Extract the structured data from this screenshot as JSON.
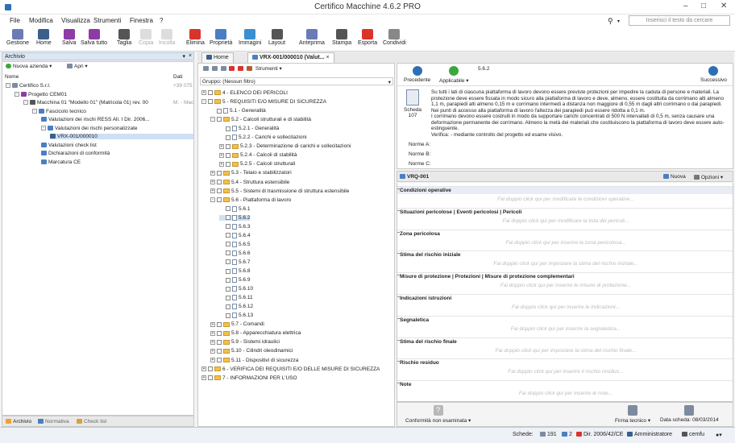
{
  "window": {
    "title": "Certifico Macchine 4.6.2 PRO"
  },
  "menu": [
    "File",
    "Modifica",
    "Visualizza",
    "Strumenti",
    "Finestra",
    "?"
  ],
  "search": {
    "placeholder": "Inserisci il testo da cercare"
  },
  "toolbar": [
    {
      "label": "Gestione",
      "icon": "gestione-icon",
      "color": "#6a7bb5",
      "enabled": true
    },
    {
      "label": "Home",
      "icon": "home-icon",
      "color": "#3b5f8a",
      "enabled": true
    },
    {
      "label": "Salva",
      "icon": "save-icon",
      "color": "#8e3ba6",
      "enabled": true
    },
    {
      "label": "Salva tutto",
      "icon": "save-all-icon",
      "color": "#8e3ba6",
      "enabled": true
    },
    {
      "label": "Taglia",
      "icon": "scissors-icon",
      "color": "#555",
      "enabled": true
    },
    {
      "label": "Copia",
      "icon": "copy-icon",
      "color": "#ccc",
      "enabled": false
    },
    {
      "label": "Incolla",
      "icon": "paste-icon",
      "color": "#ccc",
      "enabled": false
    },
    {
      "label": "Elimina",
      "icon": "delete-icon",
      "color": "#d9342b",
      "enabled": true
    },
    {
      "label": "Proprietà",
      "icon": "properties-icon",
      "color": "#4a7fc1",
      "enabled": true
    },
    {
      "label": "Immagini",
      "icon": "images-icon",
      "color": "#3a8fd0",
      "enabled": true
    },
    {
      "label": "Layout",
      "icon": "layout-icon",
      "color": "#555",
      "enabled": true
    },
    {
      "label": "Anteprima",
      "icon": "preview-icon",
      "color": "#6a7bb5",
      "enabled": true
    },
    {
      "label": "Stampa",
      "icon": "print-icon",
      "color": "#555",
      "enabled": true
    },
    {
      "label": "Esporta",
      "icon": "export-icon",
      "color": "#d9342b",
      "enabled": true
    },
    {
      "label": "Condividi",
      "icon": "share-icon",
      "color": "#888",
      "enabled": true
    }
  ],
  "archive": {
    "title": "Archivio",
    "new_company": "Nuova azienda",
    "open": "Apri",
    "col_name": "Nome",
    "col_date": "Dati",
    "tree": [
      {
        "label": "Certifico S.r.l.",
        "extra": "+39 075",
        "level": 0
      },
      {
        "label": "Progetto CEM01",
        "extra": "",
        "level": 1
      },
      {
        "label": "Macchina 01 \"Modello 01\" (Matricola 01) rev. 00",
        "extra": "M. - Macc",
        "level": 2
      },
      {
        "label": "Fascicolo tecnico",
        "extra": "",
        "level": 3
      },
      {
        "label": "Valutazioni dei rischi RESS All. I Dir. 2006...",
        "extra": "",
        "level": 4
      },
      {
        "label": "Valutazioni dei rischi personalizzate",
        "extra": "",
        "level": 4
      },
      {
        "label": "VRX-001/000010",
        "extra": "",
        "level": 5
      },
      {
        "label": "Valutazioni check list",
        "extra": "",
        "level": 4
      },
      {
        "label": "Dichiarazioni di conformità",
        "extra": "",
        "level": 4
      },
      {
        "label": "Marcatura CE",
        "extra": "",
        "level": 4
      }
    ],
    "bottom_tabs": [
      "Archivio",
      "Normativa",
      "Check list"
    ]
  },
  "tabs": [
    {
      "label": "Home"
    },
    {
      "label": "VRX-001/000010 (Valut..."
    }
  ],
  "middle": {
    "tools_label": "Strumenti",
    "group_label": "Gruppo: (Nessun filtro)",
    "tree": [
      {
        "label": "4 - ELENCO DEI PERICOLI",
        "level": 0,
        "kind": "folder"
      },
      {
        "label": "5 - REQUISITI E/O MISURE DI SICUREZZA",
        "level": 0,
        "kind": "folder"
      },
      {
        "label": "5.1 - Generalità",
        "level": 1,
        "kind": "doc"
      },
      {
        "label": "5.2 - Calcoli strutturali e di stabilità",
        "level": 1,
        "kind": "folder"
      },
      {
        "label": "5.2.1 - Generalità",
        "level": 2,
        "kind": "doc"
      },
      {
        "label": "5.2.2 - Carichi e sollecitazioni",
        "level": 2,
        "kind": "doc"
      },
      {
        "label": "5.2.3 - Determinazione di carichi e sollecitazioni",
        "level": 2,
        "kind": "folder"
      },
      {
        "label": "5.2.4 - Calcoli di stabilità",
        "level": 2,
        "kind": "folder"
      },
      {
        "label": "5.2.5 - Calcoli strutturali",
        "level": 2,
        "kind": "folder"
      },
      {
        "label": "5.3 - Telaio e stabilizzatori",
        "level": 1,
        "kind": "folder"
      },
      {
        "label": "5.4 - Struttura estensibile",
        "level": 1,
        "kind": "folder"
      },
      {
        "label": "5.5 - Sistemi di trasmissione di struttura estensibile",
        "level": 1,
        "kind": "folder"
      },
      {
        "label": "5.6 - Piattaforma di lavoro",
        "level": 1,
        "kind": "folder"
      },
      {
        "label": "5.6.1",
        "level": 2,
        "kind": "doc"
      },
      {
        "label": "5.6.2",
        "level": 2,
        "kind": "doc"
      },
      {
        "label": "5.6.3",
        "level": 2,
        "kind": "doc"
      },
      {
        "label": "5.6.4",
        "level": 2,
        "kind": "doc"
      },
      {
        "label": "5.6.5",
        "level": 2,
        "kind": "doc"
      },
      {
        "label": "5.6.6",
        "level": 2,
        "kind": "doc"
      },
      {
        "label": "5.6.7",
        "level": 2,
        "kind": "doc"
      },
      {
        "label": "5.6.8",
        "level": 2,
        "kind": "doc"
      },
      {
        "label": "5.6.9",
        "level": 2,
        "kind": "doc"
      },
      {
        "label": "5.6.10",
        "level": 2,
        "kind": "doc"
      },
      {
        "label": "5.6.11",
        "level": 2,
        "kind": "doc"
      },
      {
        "label": "5.6.12",
        "level": 2,
        "kind": "doc"
      },
      {
        "label": "5.6.13",
        "level": 2,
        "kind": "doc"
      },
      {
        "label": "5.7 - Comandi",
        "level": 1,
        "kind": "folder"
      },
      {
        "label": "5.8 - Apparecchiatura elettrica",
        "level": 1,
        "kind": "folder"
      },
      {
        "label": "5.9 - Sistemi idraulici",
        "level": 1,
        "kind": "folder"
      },
      {
        "label": "5.10 - Cilindri oleodinamici",
        "level": 1,
        "kind": "folder"
      },
      {
        "label": "5.11 - Dispositivi di sicurezza",
        "level": 1,
        "kind": "folder"
      },
      {
        "label": "6 - VERIFICA DEI REQUISITI E/O DELLE MISURE DI SICUREZZA",
        "level": 0,
        "kind": "folder"
      },
      {
        "label": "7 - INFORMAZIONI PER L'USO",
        "level": 0,
        "kind": "folder"
      }
    ]
  },
  "detail": {
    "prev": "Precedente",
    "applicable": "Applicabile",
    "code": "5.6.2",
    "next": "Successivo",
    "scheda_label": "Scheda",
    "scheda_num": "107",
    "text": "Su tutti i lati di ciascuna piattaforma di lavoro devono essere previste protezioni per impedire la caduta di persone e materiali. La protezione deve essere fissata in modo sicuro alla piattaforma di lavoro e deve, almeno, essere costituita da corrimano alti almeno 1,1 m, parapiedi alti almeno 0,15 m e corrimano intermedi a distanza non maggiore di 0,55 m dagli altri corrimano o dai parapiedi. Nei punti di accesso alla piattaforma di lavoro l'altezza dei parapiedi può essere ridotta a 0,1 m.",
    "text2": "I corrimano devono essere costruiti in modo da supportare carichi concentrati di 500 N intervallati di 0,5 m, senza causare una deformazione permanente dei corrimano. Almeno la metà dei materiali che costituiscono la piattaforma di lavoro deve essere auto-estinguente.",
    "text3": "Verifica: - mediante controllo del progetto ed esame visivo.",
    "norme": [
      "Norme A:",
      "Norme B:",
      "Norme C:"
    ]
  },
  "vrq": {
    "tab": "VRQ-001",
    "new": "Nuova",
    "options": "Opzioni",
    "sections": [
      {
        "title": "Condizioni operative",
        "hint": "Fai doppio click qui per modificare le condizioni operative..."
      },
      {
        "title": "Situazioni pericolose | Eventi pericolosi | Pericoli",
        "hint": "Fai doppio click qui per modificare la lista dei pericoli..."
      },
      {
        "title": "Zona pericolosa",
        "hint": "Fai doppio click qui per inserire la zona pericolosa..."
      },
      {
        "title": "Stima del rischio iniziale",
        "hint": "Fai doppio click qui per impostare la stima del rischio iniziale..."
      },
      {
        "title": "Misure di protezione | Protezioni | Misure di protezione complementari",
        "hint": "Fai doppio click qui per inserire le misure di protezione..."
      },
      {
        "title": "Indicazioni istruzioni",
        "hint": "Fai doppio click qui per inserire le indicazioni..."
      },
      {
        "title": "Segnaletica",
        "hint": "Fai doppio click qui per inserire la segnaletica..."
      },
      {
        "title": "Stima del rischio finale",
        "hint": "Fai doppio click qui per impostare la stima del rischio finale..."
      },
      {
        "title": "Rischio residuo",
        "hint": "Fai doppio click qui per inserire il rischio residuo..."
      },
      {
        "title": "Note",
        "hint": "Fai doppio click qui per inserire le note..."
      }
    ],
    "footer_left": "Conformità non esaminata",
    "footer_sign": "Firma tecnico",
    "footer_date": "Data scheda: 08/03/2014"
  },
  "statusbar": {
    "schede": "Schede:",
    "count1": "191",
    "count2": "2",
    "directive": "Dir. 2006/42/CE",
    "user_role": "Amministratore",
    "user": "cemfu"
  }
}
